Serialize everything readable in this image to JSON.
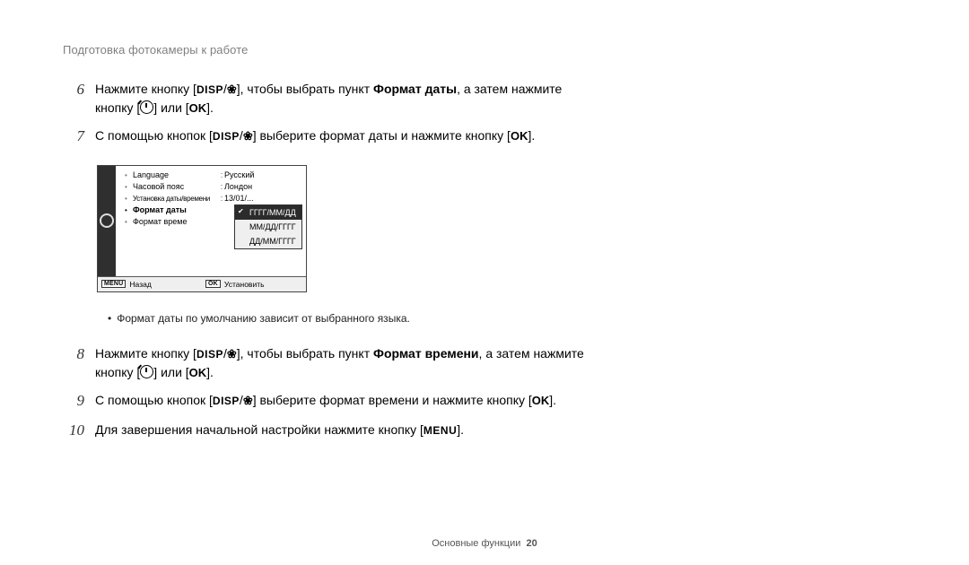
{
  "header": "Подготовка фотокамеры к работе",
  "steps": {
    "s6": {
      "num": "6",
      "pre": "Нажмите кнопку [",
      "mid1": "], чтобы выбрать пункт ",
      "bold1": "Формат даты",
      "mid2": ", а затем нажмите кнопку [",
      "mid3": "] или [",
      "end": "]."
    },
    "s7": {
      "num": "7",
      "pre": "С помощью кнопок [",
      "mid1": "] выберите формат даты и нажмите кнопку [",
      "end": "]."
    },
    "s8": {
      "num": "8",
      "pre": "Нажмите кнопку [",
      "mid1": "], чтобы выбрать пункт ",
      "bold1": "Формат времени",
      "mid2": ", а затем нажмите кнопку [",
      "mid3": "] или [",
      "end": "]."
    },
    "s9": {
      "num": "9",
      "pre": "С помощью кнопок [",
      "mid1": "] выберите формат времени и нажмите кнопку [",
      "end": "]."
    },
    "s10": {
      "num": "10",
      "pre": "Для завершения начальной настройки нажмите кнопку [",
      "end": "]."
    }
  },
  "icons": {
    "disp": "DISP",
    "flower": "❀",
    "ok": "OK",
    "menu": "MENU"
  },
  "screen": {
    "rows": {
      "language": {
        "label": "Language",
        "value": "Русский"
      },
      "timezone": {
        "label": "Часовой пояс",
        "value": "Лондон"
      },
      "datetime": {
        "label": "Установка даты/времени",
        "value": "13/01/..."
      },
      "dateformat": {
        "label": "Формат даты"
      },
      "timeformat": {
        "label": "Формат време"
      }
    },
    "dropdown": {
      "opt1": "ГГГГ/ММ/ДД",
      "opt2": "ММ/ДД/ГГГГ",
      "opt3": "ДД/ММ/ГГГГ"
    },
    "footer": {
      "back_btn": "MENU",
      "back_label": "Назад",
      "set_btn": "OK",
      "set_label": "Установить"
    }
  },
  "note": "Формат даты по умолчанию зависит от выбранного языка.",
  "footer": {
    "section": "Основные функции",
    "page": "20"
  }
}
